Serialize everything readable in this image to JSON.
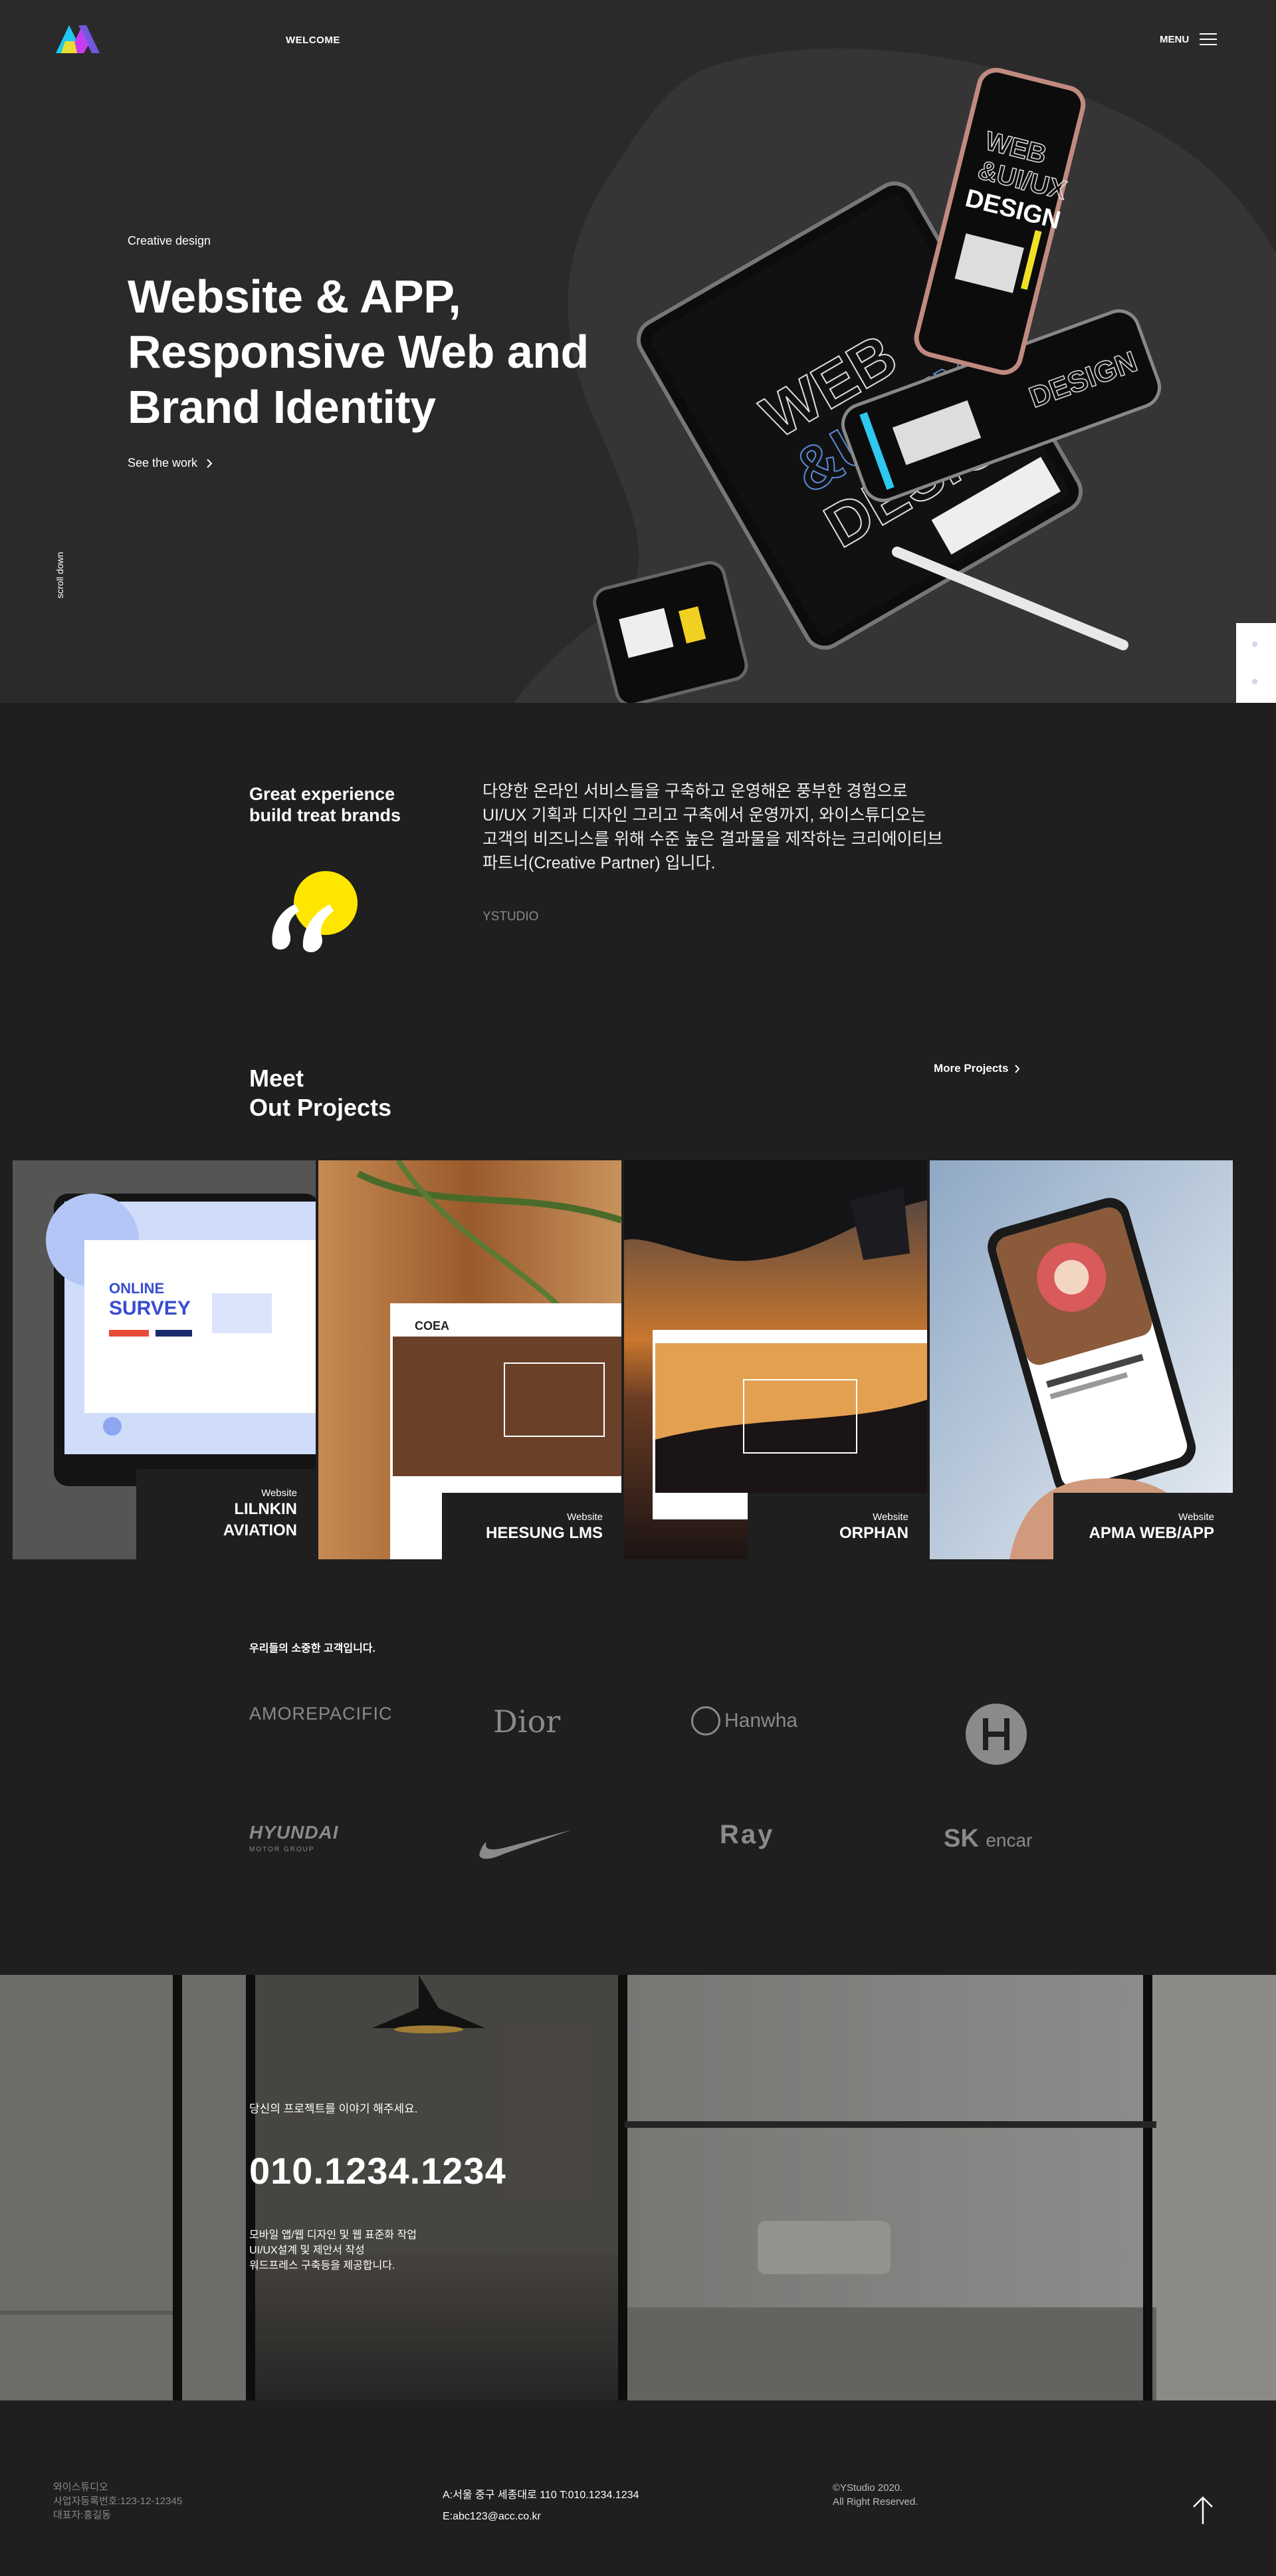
{
  "colors": {
    "background": "#1f1f1f",
    "hero_background": "#2a2a2a",
    "accent_yellow": "#ffe600",
    "logo_cyan": "#1ec8f0",
    "logo_magenta": "#c83cf0",
    "logo_yellow": "#f0e028",
    "muted": "#888888"
  },
  "header": {
    "logo_icon": "ystudio-logo-icon",
    "welcome": "WELCOME",
    "menu_label": "MENU",
    "menu_icon": "hamburger-icon"
  },
  "hero": {
    "eyebrow": "Creative design",
    "title": "Website & APP,\nResponsive Web and\nBrand Identity",
    "cta": "See the work",
    "cta_icon": "chevron-right-icon",
    "scroll": "scroll down"
  },
  "experience": {
    "title": "Great experience\nbuild treat brands",
    "quote_icon": "quote-icon",
    "body": "다양한 온라인 서비스들을 구축하고 운영해온 풍부한 경험으로\nUI/UX 기획과 디자인 그리고 구축에서 운영까지, 와이스튜디오는\n고객의 비즈니스를 위해 수준 높은 결과물을 제작하는 크리에이티브\n파트너(Creative Partner) 입니다.",
    "signature": "YSTUDIO"
  },
  "projects": {
    "heading": "Meet\nOut Projects",
    "more": "More Projects",
    "items": [
      {
        "category": "Website",
        "name": "LILNKIN\nAVIATION"
      },
      {
        "category": "Website",
        "name": "HEESUNG LMS"
      },
      {
        "category": "Website",
        "name": "ORPHAN"
      },
      {
        "category": "Website",
        "name": "APMA WEB/APP"
      }
    ]
  },
  "clients": {
    "title": "우리들의 소중한 고객입니다.",
    "logos": {
      "amore": "AMOREPACIFIC",
      "dior": "Dior",
      "hanwha": "Hanwha",
      "hyundai": "HYUNDAI",
      "hyundai_sub": "MOTOR GROUP",
      "ray": "Ray",
      "sk": "SK",
      "encar": "encar"
    }
  },
  "contact": {
    "intro": "당신의 프로젝트를 이야기 해주세요.",
    "phone": "010.1234.1234",
    "desc": "모바일 앱/웹 디자인 및 웹 표준화 작업\nUI/UX설계 및 제안서 작성\n워드프레스 구축등을 제공합니다."
  },
  "footer": {
    "company": "와이스튜디오\n사업자등록번호:123-12-12345\n대표자:홍길동",
    "address": "A:서울 중구 세종대로 110 T:010.1234.1234\nE:abc123@acc.co.kr",
    "copyright": "©YStudio 2020.\nAll Right Reserved.",
    "top_icon": "arrow-up-icon"
  }
}
